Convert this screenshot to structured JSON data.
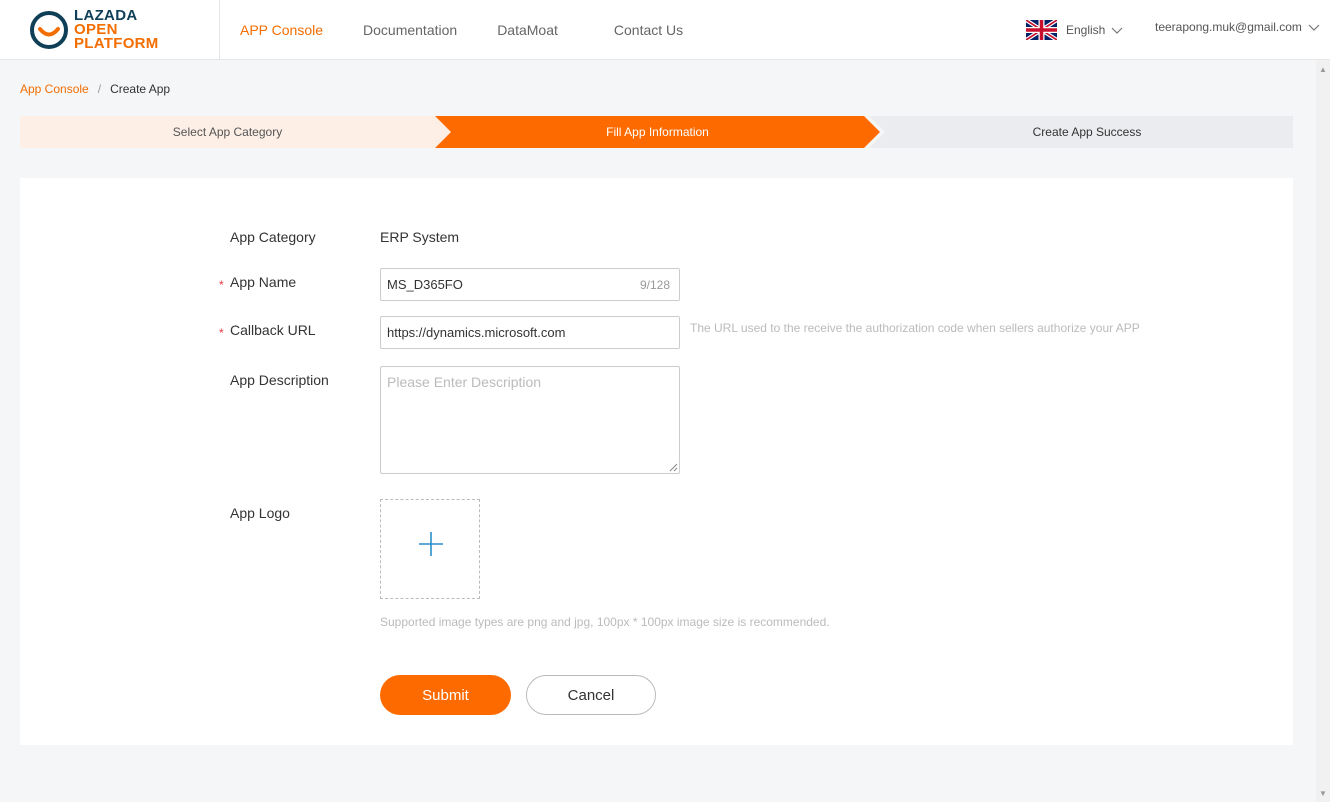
{
  "brand": {
    "line1": "LAZADA",
    "line2": "OPEN",
    "line3": "PLATFORM",
    "colors": {
      "navy": "#0f3f57",
      "orange": "#f36d00"
    }
  },
  "nav": {
    "items": [
      {
        "label": "APP Console",
        "active": true
      },
      {
        "label": "Documentation",
        "active": false
      },
      {
        "label": "DataMoat",
        "active": false
      },
      {
        "label": "Contact Us",
        "active": false
      }
    ]
  },
  "header_right": {
    "language": "English",
    "flag_icon": "uk-flag-icon",
    "user_email": "teerapong.muk@gmail.com"
  },
  "breadcrumb": {
    "root": "App Console",
    "separator": "/",
    "current": "Create App"
  },
  "steps": [
    {
      "label": "Select App Category",
      "state": "done"
    },
    {
      "label": "Fill App Information",
      "state": "current"
    },
    {
      "label": "Create App Success",
      "state": "pending"
    }
  ],
  "form": {
    "app_category": {
      "label": "App Category",
      "value": "ERP System"
    },
    "app_name": {
      "label": "App Name",
      "required_mark": "*",
      "value": "MS_D365FO",
      "counter": "9/128"
    },
    "callback_url": {
      "label": "Callback URL",
      "required_mark": "*",
      "value": "https://dynamics.microsoft.com",
      "hint": "The URL used to the receive the authorization code when sellers authorize your APP"
    },
    "app_description": {
      "label": "App Description",
      "placeholder": "Please Enter Description"
    },
    "app_logo": {
      "label": "App Logo",
      "hint": "Supported image types are png and jpg, 100px * 100px image size is recommended."
    }
  },
  "buttons": {
    "submit": "Submit",
    "cancel": "Cancel"
  },
  "colors": {
    "accent": "#fd6b00",
    "step_done_bg": "#fdefe6",
    "step_pending_bg": "#ebecef",
    "required": "#e4393c",
    "upload_plus": "#2a8fc9"
  }
}
